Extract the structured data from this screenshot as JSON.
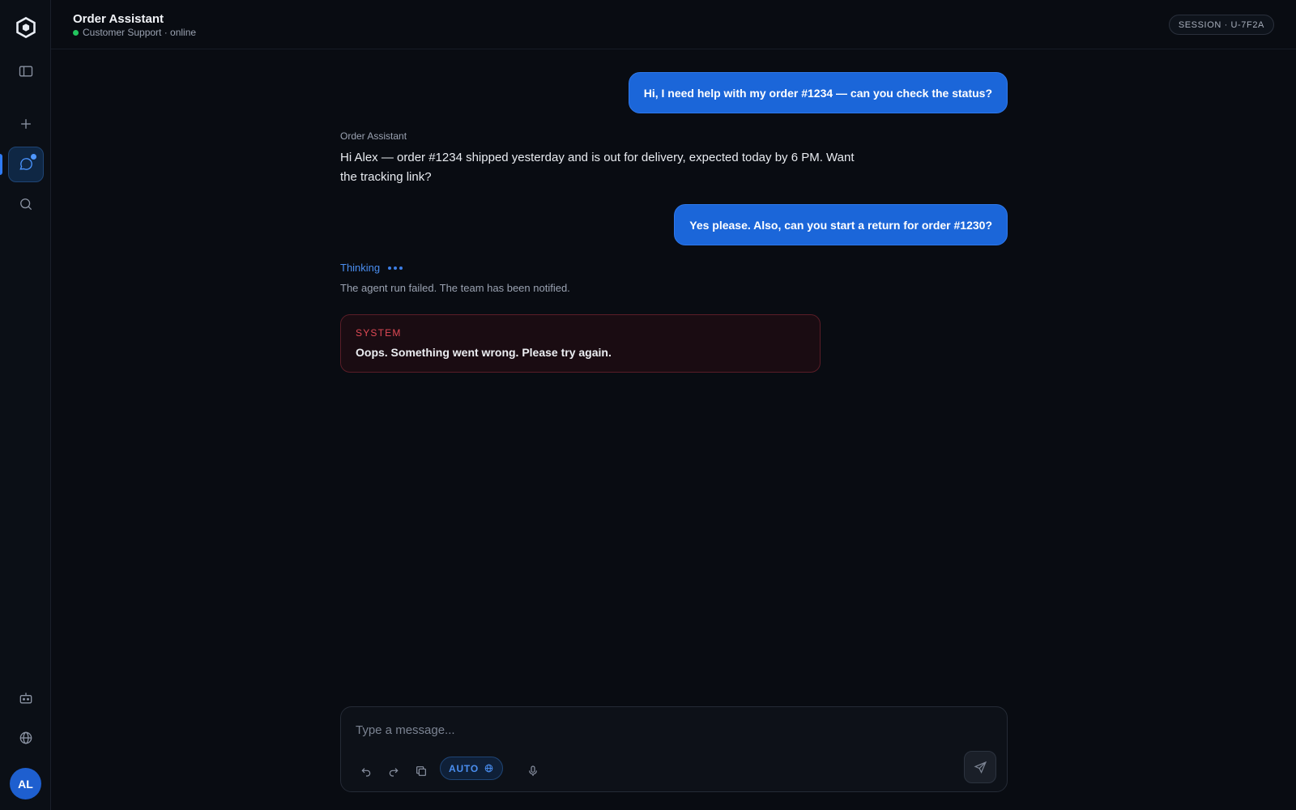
{
  "header": {
    "title": "Order Assistant",
    "subtitle": "Customer Support · online",
    "session": "SESSION · U-7F2A"
  },
  "sidebar": {
    "items": [
      {
        "name": "logo",
        "icon": "hexagon-logo-icon"
      },
      {
        "name": "toggle-sidebar",
        "icon": "sidebar-panel-icon"
      },
      {
        "name": "new-chat",
        "icon": "plus-icon"
      },
      {
        "name": "chats",
        "icon": "chat-bubble-icon",
        "active": true,
        "notification": true
      },
      {
        "name": "search",
        "icon": "search-icon"
      },
      {
        "name": "agents",
        "icon": "robot-icon"
      },
      {
        "name": "language",
        "icon": "globe-icon"
      }
    ],
    "avatar_initials": "AL"
  },
  "messages": [
    {
      "role": "user",
      "text": "Hi, I need help with my order #1234 — can you check the status?"
    },
    {
      "role": "assistant",
      "author": "Order Assistant",
      "text": "Hi Alex — order #1234 shipped yesterday and is out for delivery, expected today by 6 PM. Want the tracking link?"
    },
    {
      "role": "user",
      "text": "Yes please. Also, can you start a return for order #1230?"
    }
  ],
  "thinking": {
    "label": "Thinking",
    "status": "The agent run failed. The team has been notified."
  },
  "error": {
    "label": "SYSTEM",
    "message": "Oops. Something went wrong. Please try again."
  },
  "composer": {
    "placeholder": "Type a message...",
    "value": "",
    "mode_label": "AUTO",
    "tools": [
      "undo-icon",
      "redo-icon",
      "copy-icon",
      "microphone-icon"
    ],
    "send_icon": "send-icon"
  },
  "colors": {
    "background": "#090c12",
    "accent": "#1b66d9",
    "error": "#e04a55",
    "online": "#22c55e"
  }
}
